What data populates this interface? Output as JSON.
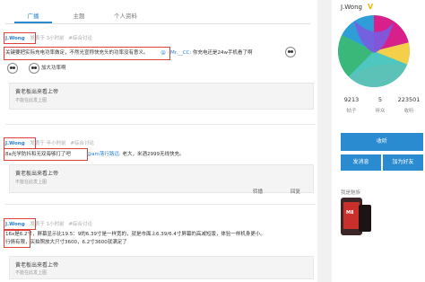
{
  "tabs": [
    {
      "label": "广播",
      "active": true
    },
    {
      "label": "主题",
      "active": false
    },
    {
      "label": "个人资料",
      "active": false
    }
  ],
  "posts": [
    {
      "author": "J.Wong",
      "meta": "发表于 3小时前",
      "topic": "#综合讨论",
      "text_prefix": "关键要把实际充电功率做足，不然光宣称快充头的功率没有意义。",
      "mention": "@ · Mr.__CC:",
      "text_suffix": "你充电还是24w手机看了啊",
      "line2": "加大功率啊",
      "quote_title": "黄老板出来看上帝",
      "quote_sub": "不能在此发上图"
    },
    {
      "author": "J.Wong",
      "meta": "发表于 半小时前",
      "topic": "#综合讨论",
      "text_prefix": "8a光学防抖和无双海够打了吧",
      "mention": "@am落行路远:",
      "text_suffix": "老大，米酒2999无线快充。",
      "quote_title": "黄老板出来看上帝",
      "quote_sub": "不能在此发上图",
      "action_repost": "转播",
      "action_reply": "回复"
    },
    {
      "author": "J.Wong",
      "meta": "发表于 1小时前",
      "topic": "#综合讨论",
      "line1": "16x是6.2寸，",
      "line1_rest": "屏幕显示比19.5：9的6.39寸是一样宽的，就是市面上6.39/6.4寸屏幕的高减短版，体验一样机身更小。",
      "line2": "行情有限，",
      "line2_rest": "买拍照放大只寸3600，6.2寸3600就满足了",
      "quote_title": "黄老板出来看上帝",
      "quote_sub": "不能在此发上图"
    }
  ],
  "profile": {
    "name": "J.Wong",
    "badge": "V",
    "stats": [
      {
        "value": "9213",
        "label": "帖子"
      },
      {
        "value": "5",
        "label": "听众"
      },
      {
        "value": "223501",
        "label": "收听"
      }
    ],
    "follow_label": "收听",
    "message_label": "发消息",
    "add_friend_label": "加为好友",
    "device_label": "我是魅族",
    "device_logo": "M8"
  },
  "colors": {
    "accent": "#2a8bd0",
    "highlight": "#e0413a"
  }
}
